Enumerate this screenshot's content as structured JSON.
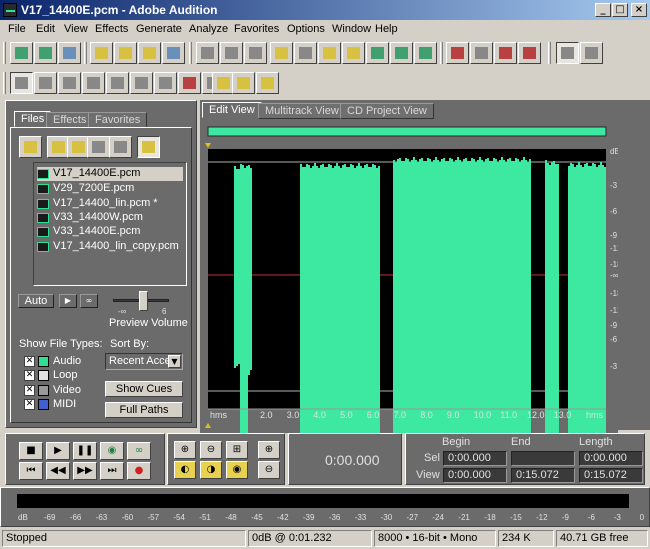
{
  "window": {
    "title": "V17_14400E.pcm - Adobe Audition",
    "min": "_",
    "max": "□",
    "close": "×"
  },
  "menu": [
    "File",
    "Edit",
    "View",
    "Effects",
    "Generate",
    "Analyze",
    "Favorites",
    "Options",
    "Window",
    "Help"
  ],
  "panel": {
    "tabs": [
      "Files",
      "Effects",
      "Favorites"
    ],
    "files": [
      "V17_14400E.pcm",
      "V29_7200E.pcm",
      "V17_14400_lin.pcm *",
      "V33_14400W.pcm",
      "V33_14400E.pcm",
      "V17_14400_lin_copy.pcm"
    ],
    "auto_label": "Auto",
    "preview_label": "Preview Volume",
    "preview_min": "-∞",
    "preview_max": "6",
    "preview_volume": 0.55,
    "show_types_label": "Show File Types:",
    "types": [
      {
        "label": "Audio",
        "checked": true
      },
      {
        "label": "Loop",
        "checked": true
      },
      {
        "label": "Video",
        "checked": true
      },
      {
        "label": "MIDI",
        "checked": true
      }
    ],
    "sort_label": "Sort By:",
    "sort_value": "Recent Acce",
    "show_cues": "Show Cues",
    "full_paths": "Full Paths"
  },
  "views": [
    "Edit View",
    "Multitrack View",
    "CD Project View"
  ],
  "wave": {
    "colors": {
      "wave": "#3de8a0",
      "bg": "#000000",
      "center": "#c03030",
      "range": "#3de8a0"
    },
    "db_labels": [
      "dB",
      "-3",
      "-6",
      "-9",
      "-12",
      "-18",
      "-∞",
      "-18",
      "-12",
      "-9",
      "-6",
      "-3"
    ],
    "time_labels": [
      "hms",
      "2.0",
      "3.0",
      "4.0",
      "5.0",
      "6.0",
      "7.0",
      "8.0",
      "9.0",
      "10.0",
      "11.0",
      "12.0",
      "13.0",
      "hms"
    ]
  },
  "transport": {
    "time": "0:00.000"
  },
  "selview": {
    "headers": [
      "Begin",
      "End",
      "Length"
    ],
    "sel_label": "Sel",
    "view_label": "View",
    "sel": [
      "0:00.000",
      "",
      "0:00.000"
    ],
    "view": [
      "0:00.000",
      "0:15.072",
      "0:15.072"
    ]
  },
  "meter": {
    "labels": [
      "dB",
      "-69",
      "-66",
      "-63",
      "-60",
      "-57",
      "-54",
      "-51",
      "-48",
      "-45",
      "-42",
      "-39",
      "-36",
      "-33",
      "-30",
      "-27",
      "-24",
      "-21",
      "-18",
      "-15",
      "-12",
      "-9",
      "-6",
      "-3",
      "0"
    ]
  },
  "status": {
    "state": "Stopped",
    "level": "0dB @ 0:01.232",
    "format": "8000 • 16-bit • Mono",
    "size": "234 K",
    "free": "40.71 GB free"
  }
}
